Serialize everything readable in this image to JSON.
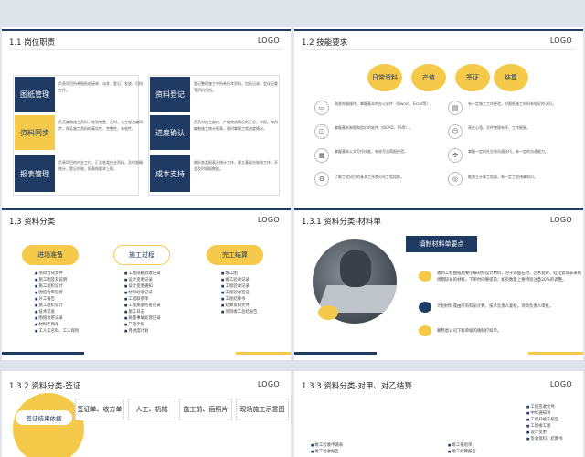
{
  "slide1": {
    "title": "1.1  岗位职责",
    "logo": "LOGO",
    "items": [
      {
        "label": "图纸管理",
        "desc": "负责项目所有图纸的接收、派发、登记、发放、归档工作。"
      },
      {
        "label": "资料登记",
        "desc": "登记整理施工中所有技术资料，包括记录、会议纪要等资料归档。"
      },
      {
        "label": "资料同步",
        "desc": "负责编制施工资料，做到完整、及时，与工程进度同步，保证施工资料的真实性、完整性、有效性。"
      },
      {
        "label": "进度确认",
        "desc": "负责对施工部位、产值完成情况的汇总、申报，按月编制施工统计报表，随时掌握工程进度情况。"
      },
      {
        "label": "报表管理",
        "desc": "负责项目的内业工作，汇总各类内业资料，及时准确统计，登记台账，报表按要求上报。"
      },
      {
        "label": "成本支持",
        "desc": "做好各类报表及统计工作，建立基础台账和工作，开会及时填报数据。"
      }
    ]
  },
  "slide2": {
    "title": "1.2  技能要求",
    "logo": "LOGO",
    "pills": [
      "日常资料",
      "产值",
      "签证",
      "结算"
    ],
    "rows": [
      {
        "icon": "monitor-icon",
        "text": "熟悉电脑操作，掌握基本的办公软件（如word、Excel等）。"
      },
      {
        "icon": "clipboard-icon",
        "text": "有一定施工工作经验，对图纸施工材料有较好的认识。"
      },
      {
        "icon": "cad-icon",
        "text": "掌握基本制图和造价的软件（如CAD、PS等）。"
      },
      {
        "icon": "person-icon",
        "text": "责任心强，文件整理有序，工作细致。"
      },
      {
        "icon": "calendar-icon",
        "text": "掌握基本公文写作技能，有较写出简报经验。"
      },
      {
        "icon": "network-icon",
        "text": "掌握一定的社交和沟通技巧，有一定的沟通能力。"
      },
      {
        "icon": "gear-icon",
        "text": "了解工程项目的基本工序和分项工程组织。"
      },
      {
        "icon": "coin-icon",
        "text": "能独立计算工程量，有一定工程预算知识。"
      }
    ]
  },
  "slide3": {
    "title": "1.3  资料分类",
    "logo": "LOGO",
    "categories": [
      {
        "label": "进场准备",
        "items": [
          "项目合同文件",
          "施工图及其说明",
          "施工组织设计",
          "图纸会审纪要",
          "开工报告",
          "施工组织设计",
          "技术交底",
          "图纸会审记录",
          "材料申购单",
          "工人实名制、工人保险"
        ]
      },
      {
        "label": "施工过程",
        "items": [
          "工程隐蔽验收记录",
          "设计变更记录",
          "设计变更通知",
          "材料验收记录",
          "工程联系单",
          "工程质量检查记录",
          "施工日志",
          "质量事故处理记录",
          "产值申报",
          "月进度计划"
        ]
      },
      {
        "label": "完工结算",
        "items": [
          "竣工图",
          "竣工验收记录",
          "工程验收记录",
          "工程验收签证",
          "工程结算书",
          "结算资料文件",
          "项目竣工总结报告"
        ]
      }
    ]
  },
  "slide4": {
    "title": "1.3.1  资料分类-材料单",
    "logo": "LOGO",
    "heading": "填制材料单要点",
    "points": [
      "收到工程图纸后要仔细对照设计材料，对于饰面石材、艺术瓷砖、硅化瓷等非采购周期较长的材料，下单时间要提前；如有数量上要特别注意20%的调整。",
      "计划材料或由所有料员计算，技术负责人复核，项目负责人审批。",
      "要熟悉公司下料单据的填制打样单。"
    ]
  },
  "slide5": {
    "title": "1.3.2  资料分类-签证",
    "logo": "LOGO",
    "main": "签证结果依据",
    "buttons": [
      "签证单、收方单",
      "人工、机械",
      "施工前、后照片",
      "现场施工示意图"
    ]
  },
  "slide6": {
    "title": "1.3.3  资料分类-对甲、对乙结算",
    "logo": "LOGO",
    "col1": [
      "竣工验收申请表",
      "竣工验收报告"
    ],
    "col2": [
      "竣工报验单",
      "竣工结算报告"
    ],
    "col3": [
      "工程签收文件",
      "中标通知书",
      "工程开竣工报告",
      "工程竣工图",
      "设计变更",
      "签收资料、结算书"
    ]
  }
}
